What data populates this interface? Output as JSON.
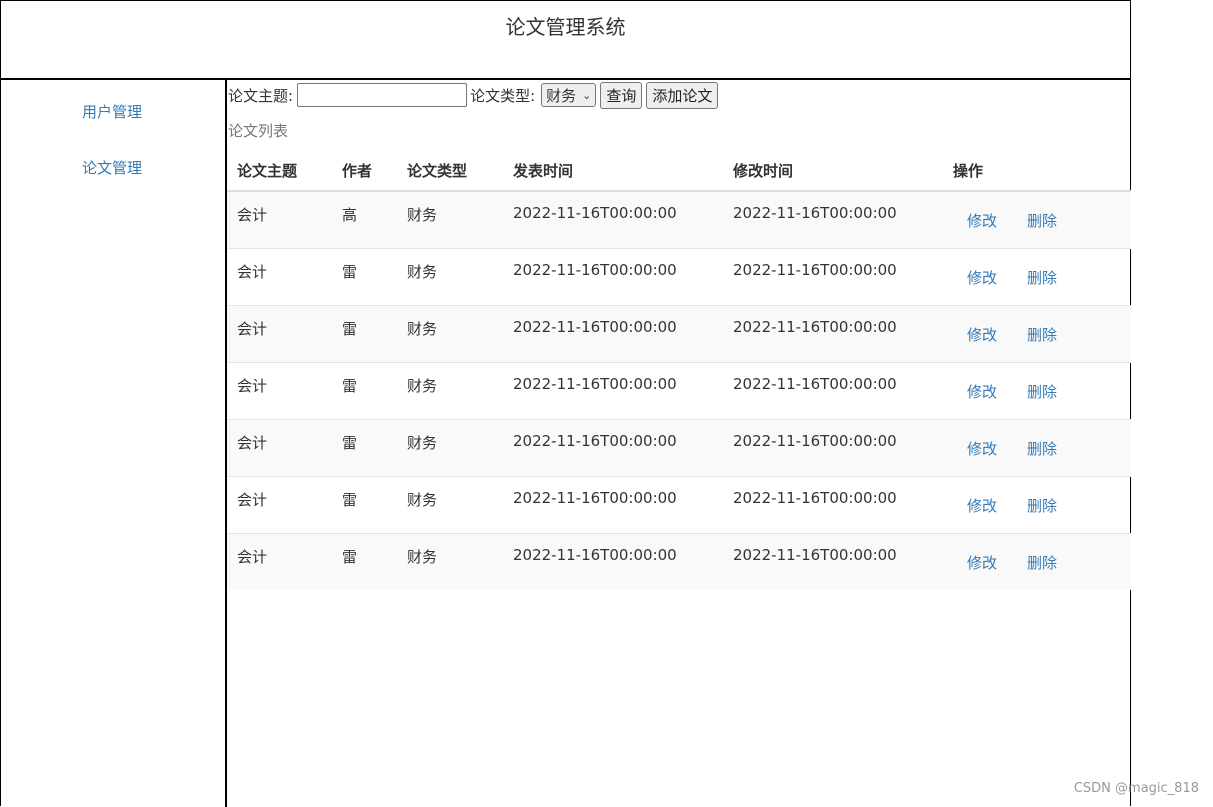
{
  "header": {
    "title": "论文管理系统"
  },
  "sidebar": {
    "items": [
      {
        "label": "用户管理"
      },
      {
        "label": "论文管理"
      }
    ]
  },
  "search": {
    "topic_label": "论文主题:",
    "topic_value": "",
    "type_label": "论文类型:",
    "type_selected": "财务",
    "query_button": "查询",
    "add_button": "添加论文"
  },
  "list": {
    "caption": "论文列表",
    "columns": [
      "论文主题",
      "作者",
      "论文类型",
      "发表时间",
      "修改时间",
      "操作"
    ],
    "rows": [
      {
        "topic": "会计",
        "author": "高",
        "type": "财务",
        "published": "2022-11-16T00:00:00",
        "modified": "2022-11-16T00:00:00",
        "edit": "修改",
        "delete": "删除"
      },
      {
        "topic": "会计",
        "author": "雷",
        "type": "财务",
        "published": "2022-11-16T00:00:00",
        "modified": "2022-11-16T00:00:00",
        "edit": "修改",
        "delete": "删除"
      },
      {
        "topic": "会计",
        "author": "雷",
        "type": "财务",
        "published": "2022-11-16T00:00:00",
        "modified": "2022-11-16T00:00:00",
        "edit": "修改",
        "delete": "删除"
      },
      {
        "topic": "会计",
        "author": "雷",
        "type": "财务",
        "published": "2022-11-16T00:00:00",
        "modified": "2022-11-16T00:00:00",
        "edit": "修改",
        "delete": "删除"
      },
      {
        "topic": "会计",
        "author": "雷",
        "type": "财务",
        "published": "2022-11-16T00:00:00",
        "modified": "2022-11-16T00:00:00",
        "edit": "修改",
        "delete": "删除"
      },
      {
        "topic": "会计",
        "author": "雷",
        "type": "财务",
        "published": "2022-11-16T00:00:00",
        "modified": "2022-11-16T00:00:00",
        "edit": "修改",
        "delete": "删除"
      },
      {
        "topic": "会计",
        "author": "雷",
        "type": "财务",
        "published": "2022-11-16T00:00:00",
        "modified": "2022-11-16T00:00:00",
        "edit": "修改",
        "delete": "删除"
      }
    ]
  },
  "watermark": "CSDN @magic_818",
  "colors": {
    "link": "#337ab7",
    "stripe": "#f9f9f9",
    "border": "#000000"
  },
  "icons": {
    "select_chevron": "chevron-down-icon"
  }
}
